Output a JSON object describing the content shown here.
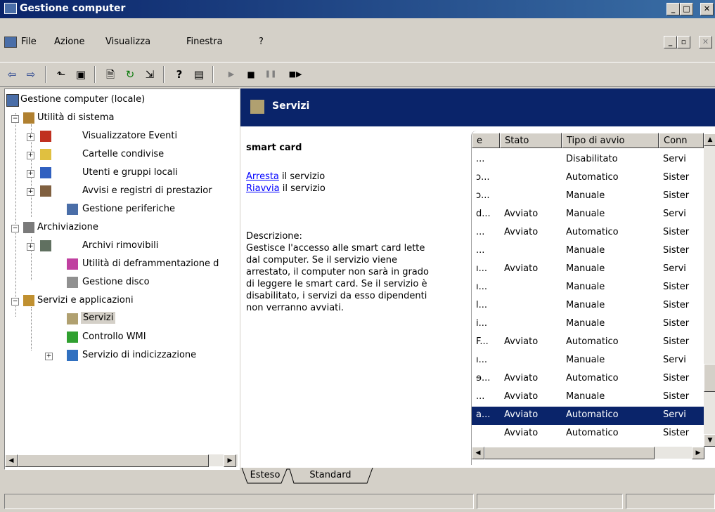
{
  "window": {
    "title": "Gestione computer",
    "controls": [
      "_",
      "□",
      "✕"
    ]
  },
  "menu": {
    "items": [
      {
        "label": "File",
        "accel": "F"
      },
      {
        "label": "Azione",
        "accel": "A"
      },
      {
        "label": "Visualizza",
        "accel": "V"
      },
      {
        "label": "Finestra",
        "accel": "n"
      },
      {
        "label": "?",
        "accel": "?"
      }
    ],
    "mdi_controls": [
      "_",
      "▫",
      "✕"
    ]
  },
  "toolbar": {
    "icons": [
      "back-icon",
      "forward-icon",
      "up-folder-icon",
      "show-hide-tree-icon",
      "properties-icon",
      "refresh-icon",
      "export-list-icon",
      "help-icon",
      "console-icon",
      "play-icon",
      "stop-icon",
      "pause-icon",
      "restart-icon"
    ],
    "glyphs": [
      "⇦",
      "⇨",
      "⬑",
      "▣",
      "🗎",
      "↻",
      "⇲",
      "?",
      "▤",
      "▶",
      "■",
      "❚❚",
      "■▶"
    ]
  },
  "tree": {
    "items": [
      {
        "label": "Gestione computer (locale)",
        "icon": "computer-icon",
        "level": 0
      },
      {
        "label": "Utilità di sistema",
        "icon": "tools-icon",
        "level": 1,
        "expander": "−"
      },
      {
        "label": "Visualizzatore Eventi",
        "icon": "event-viewer-icon",
        "level": 2,
        "expander": "+"
      },
      {
        "label": "Cartelle condivise",
        "icon": "shared-folder-icon",
        "level": 2,
        "expander": "+"
      },
      {
        "label": "Utenti e gruppi locali",
        "icon": "users-icon",
        "level": 2,
        "expander": "+"
      },
      {
        "label": "Avvisi e registri di prestazior",
        "icon": "performance-icon",
        "level": 2,
        "expander": "+"
      },
      {
        "label": "Gestione periferiche",
        "icon": "device-manager-icon",
        "level": 2
      },
      {
        "label": "Archiviazione",
        "icon": "storage-icon",
        "level": 1,
        "expander": "−"
      },
      {
        "label": "Archivi rimovibili",
        "icon": "removable-storage-icon",
        "level": 2,
        "expander": "+"
      },
      {
        "label": "Utilità di deframmentazione d",
        "icon": "defrag-icon",
        "level": 2
      },
      {
        "label": "Gestione disco",
        "icon": "disk-icon",
        "level": 2
      },
      {
        "label": "Servizi e applicazioni",
        "icon": "services-apps-icon",
        "level": 1,
        "expander": "−"
      },
      {
        "label": "Servizi",
        "icon": "gears-icon",
        "level": 2,
        "selected": true
      },
      {
        "label": "Controllo WMI",
        "icon": "wmi-icon",
        "level": 2
      },
      {
        "label": "Servizio di indicizzazione",
        "icon": "indexing-icon",
        "level": 2,
        "expander": "+"
      }
    ]
  },
  "services": {
    "header": "Servizi",
    "selected_name": "smart card",
    "stop_link": "Arresta",
    "stop_suffix": " il servizio",
    "restart_link": "Riavvia",
    "restart_suffix": " il servizio",
    "description_label": "Descrizione:",
    "description_lines": [
      "Gestisce l'accesso alle smart card lette",
      "dal computer. Se il servizio viene",
      "arrestato, il computer non sarà in grado",
      "di leggere le smart card. Se il servizio è",
      "disabilitato, i servizi da esso dipendenti",
      "non verranno avviati."
    ],
    "columns": [
      "e",
      "Stato",
      "Tipo di avvio",
      "Conn"
    ],
    "rows": [
      {
        "c0": "...",
        "stato": "",
        "tipo": "Disabilitato",
        "conn": "Servi"
      },
      {
        "c0": "ɔ...",
        "stato": "",
        "tipo": "Automatico",
        "conn": "Sister"
      },
      {
        "c0": "ɔ...",
        "stato": "",
        "tipo": "Manuale",
        "conn": "Sister"
      },
      {
        "c0": "d...",
        "stato": "Avviato",
        "tipo": "Manuale",
        "conn": "Servi"
      },
      {
        "c0": "...",
        "stato": "Avviato",
        "tipo": "Automatico",
        "conn": "Sister"
      },
      {
        "c0": "...",
        "stato": "",
        "tipo": "Manuale",
        "conn": "Sister"
      },
      {
        "c0": "ı...",
        "stato": "Avviato",
        "tipo": "Manuale",
        "conn": "Servi"
      },
      {
        "c0": "ı...",
        "stato": "",
        "tipo": "Manuale",
        "conn": "Sister"
      },
      {
        "c0": "l...",
        "stato": "",
        "tipo": "Manuale",
        "conn": "Sister"
      },
      {
        "c0": "i...",
        "stato": "",
        "tipo": "Manuale",
        "conn": "Sister"
      },
      {
        "c0": "F...",
        "stato": "Avviato",
        "tipo": "Automatico",
        "conn": "Sister"
      },
      {
        "c0": "ı...",
        "stato": "",
        "tipo": "Manuale",
        "conn": "Servi"
      },
      {
        "c0": "ɘ...",
        "stato": "Avviato",
        "tipo": "Automatico",
        "conn": "Sister"
      },
      {
        "c0": "...",
        "stato": "Avviato",
        "tipo": "Manuale",
        "conn": "Sister"
      },
      {
        "c0": "a...",
        "stato": "Avviato",
        "tipo": "Automatico",
        "conn": "Servi",
        "selected": true
      },
      {
        "c0": "",
        "stato": "Avviato",
        "tipo": "Automatico",
        "conn": "Sister"
      }
    ]
  },
  "tabs": [
    {
      "label": "Esteso",
      "active": true
    },
    {
      "label": "Standard",
      "active": false
    }
  ],
  "colors": {
    "title_bar": "#0a246a",
    "selection": "#0a246a",
    "link": "#0000ff",
    "face": "#d4d0c8"
  }
}
